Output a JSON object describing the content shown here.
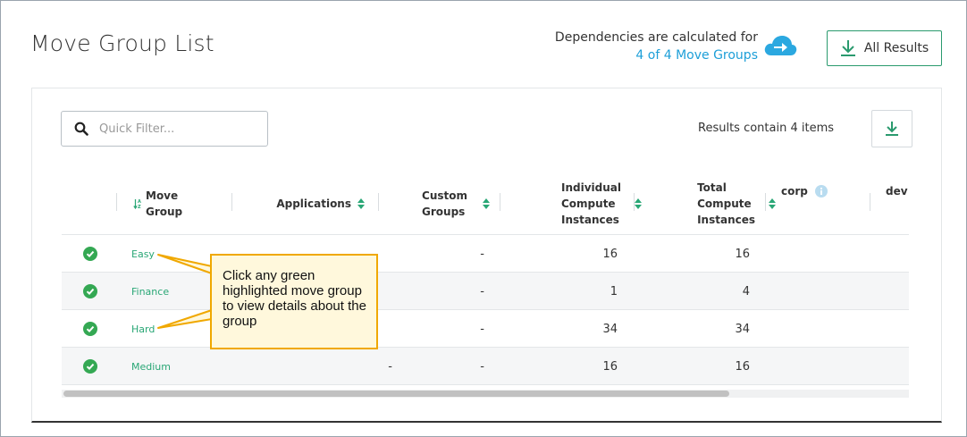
{
  "header": {
    "title": "Move Group List",
    "deps_text": "Dependencies are calculated for",
    "deps_link": "4 of 4 Move Groups",
    "all_results_label": "All Results"
  },
  "filter": {
    "placeholder": "Quick Filter...",
    "value": ""
  },
  "results_count": "Results contain 4 items",
  "table": {
    "columns": {
      "move_group_line1": "Move",
      "move_group_line2": "Group",
      "applications": "Applications",
      "custom_line1": "Custom",
      "custom_line2": "Groups",
      "ici_line1": "Individual",
      "ici_line2": "Compute",
      "ici_line3": "Instances",
      "tci_line1": "Total",
      "tci_line2": "Compute",
      "tci_line3": "Instances",
      "corp": "corp",
      "dev": "dev"
    },
    "rows": [
      {
        "name": "Easy",
        "applications": "",
        "custom_groups": "-",
        "individual": "16",
        "total": "16"
      },
      {
        "name": "Finance",
        "applications": "",
        "custom_groups": "-",
        "individual": "1",
        "total": "4"
      },
      {
        "name": "Hard",
        "applications": "",
        "custom_groups": "-",
        "individual": "34",
        "total": "34"
      },
      {
        "name": "Medium",
        "applications": "-",
        "custom_groups": "-",
        "individual": "16",
        "total": "16"
      }
    ]
  },
  "callout": {
    "text": "Click any green highlighted move group to view details about the group"
  },
  "colors": {
    "accent_green": "#2aa776",
    "link_blue": "#1d9fd8",
    "callout_border": "#f0a800",
    "callout_bg": "#fff8dc"
  },
  "icons": {
    "cloud": "cloud-arrow-icon",
    "download": "download-icon",
    "search": "search-icon",
    "sort": "sort-icon",
    "status": "check-circle-icon",
    "info": "info-icon"
  }
}
